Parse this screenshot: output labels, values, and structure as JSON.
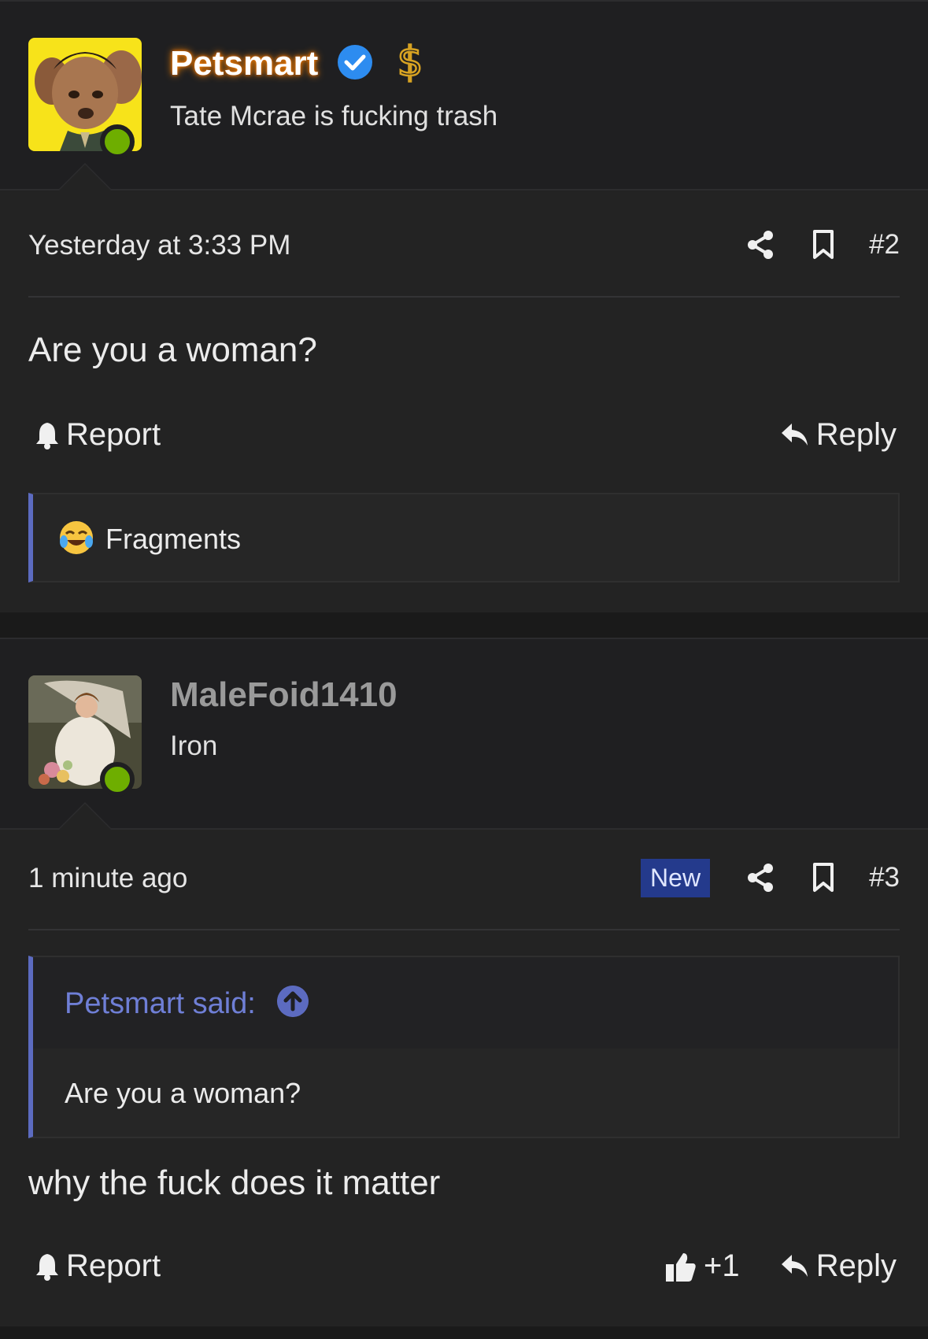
{
  "posts": [
    {
      "username": "Petsmart",
      "user_title": "Tate Mcrae is fucking trash",
      "timestamp": "Yesterday at 3:33 PM",
      "post_number": "#2",
      "content": "Are you a woman?",
      "report_label": "Report",
      "reply_label": "Reply",
      "reaction_name": "Fragments"
    },
    {
      "username": "MaleFoid1410",
      "user_title": "Iron",
      "timestamp": "1 minute ago",
      "new_badge": "New",
      "post_number": "#3",
      "quote_author": "Petsmart said:",
      "quote_text": "Are you a woman?",
      "content": "why the fuck does it matter",
      "report_label": "Report",
      "like_count": "+1",
      "reply_label": "Reply"
    }
  ],
  "colors": {
    "background": "#232323",
    "accent": "#5c6bc0",
    "online": "#6eae00",
    "verified": "#2d8cf0",
    "new_badge": "#243a8c"
  }
}
